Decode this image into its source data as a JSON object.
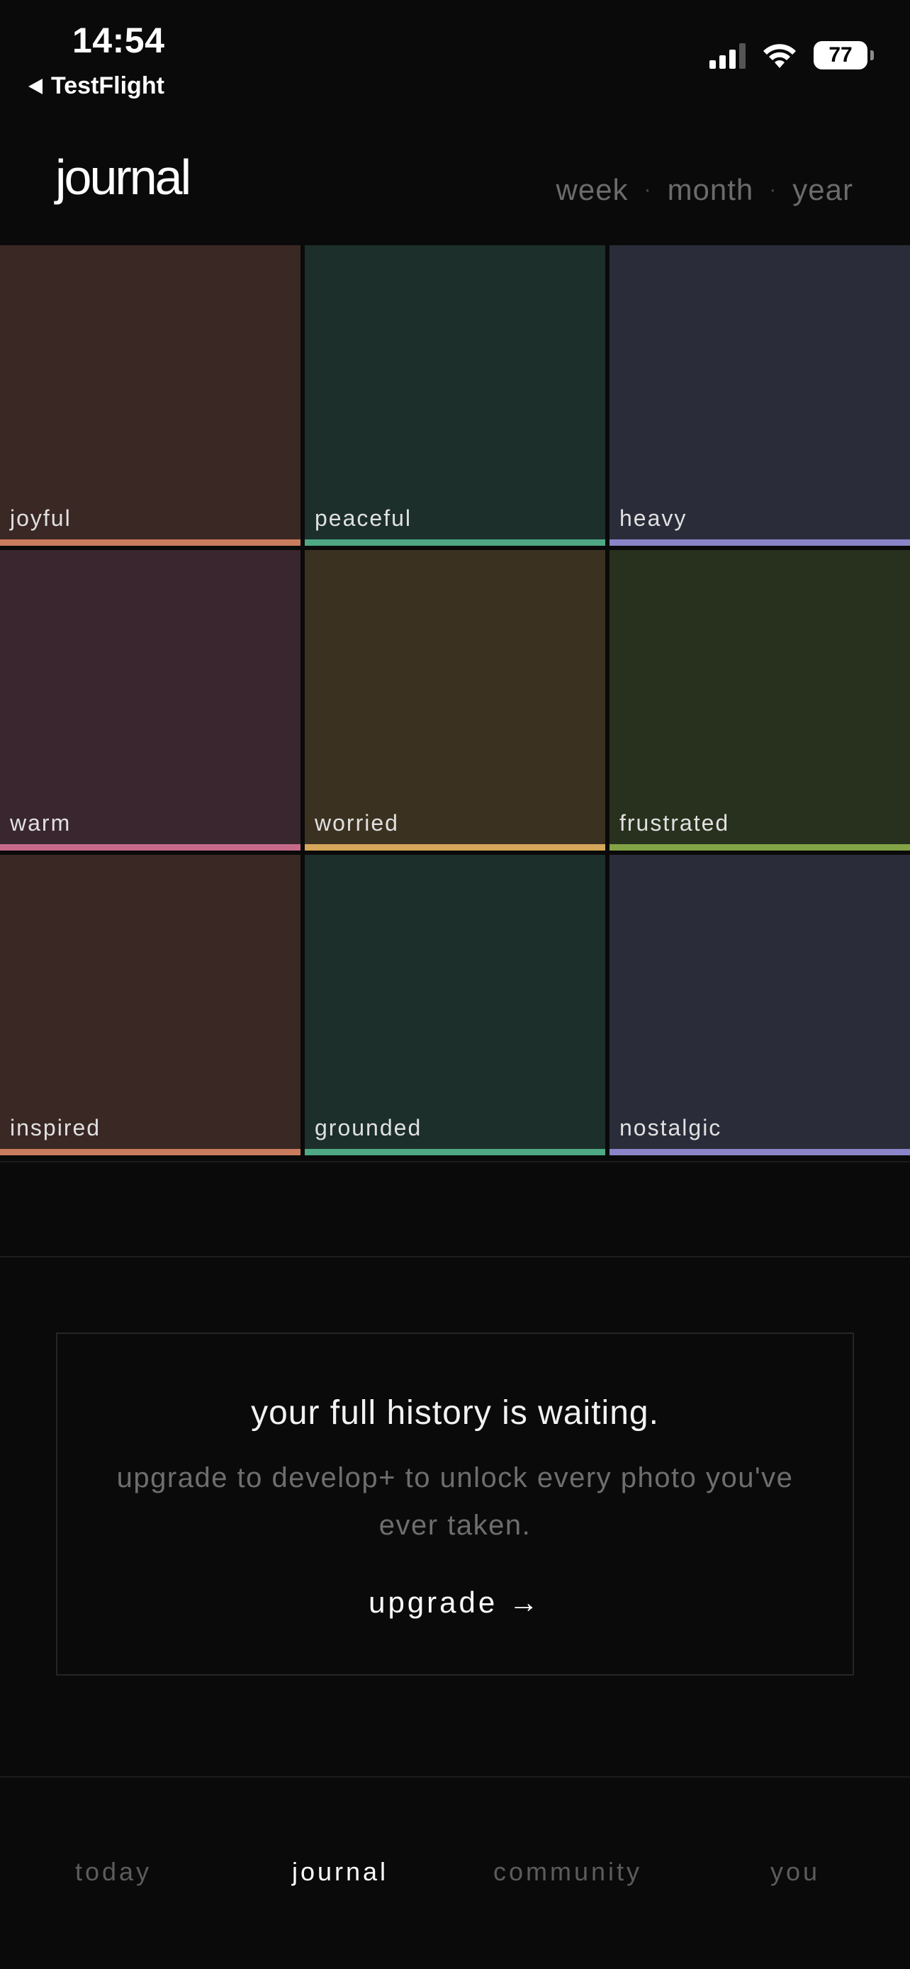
{
  "status_bar": {
    "time": "14:54",
    "back_app": "TestFlight",
    "battery_level": "77"
  },
  "header": {
    "title": "journal",
    "ranges": [
      "week",
      "month",
      "year"
    ],
    "separator": "·"
  },
  "moods": [
    {
      "label": "joyful",
      "bg": "#3a2824",
      "accent": "#c97c5d"
    },
    {
      "label": "peaceful",
      "bg": "#1c2f2a",
      "accent": "#4ea884"
    },
    {
      "label": "heavy",
      "bg": "#2b2c39",
      "accent": "#8c84c8"
    },
    {
      "label": "warm",
      "bg": "#3a262e",
      "accent": "#c76a8a"
    },
    {
      "label": "worried",
      "bg": "#3b3120",
      "accent": "#d6a75a"
    },
    {
      "label": "frustrated",
      "bg": "#28301e",
      "accent": "#82a346"
    },
    {
      "label": "inspired",
      "bg": "#3a2824",
      "accent": "#c97c5d"
    },
    {
      "label": "grounded",
      "bg": "#1c2f2a",
      "accent": "#4ea884"
    },
    {
      "label": "nostalgic",
      "bg": "#2b2c39",
      "accent": "#8c84c8"
    }
  ],
  "upgrade_card": {
    "title": "your full history is waiting.",
    "subtitle": "upgrade to develop+ to unlock every photo you've ever taken.",
    "cta": "upgrade →"
  },
  "bottom_nav": {
    "items": [
      {
        "label": "today",
        "active": false
      },
      {
        "label": "journal",
        "active": true
      },
      {
        "label": "community",
        "active": false
      },
      {
        "label": "you",
        "active": false
      }
    ]
  }
}
